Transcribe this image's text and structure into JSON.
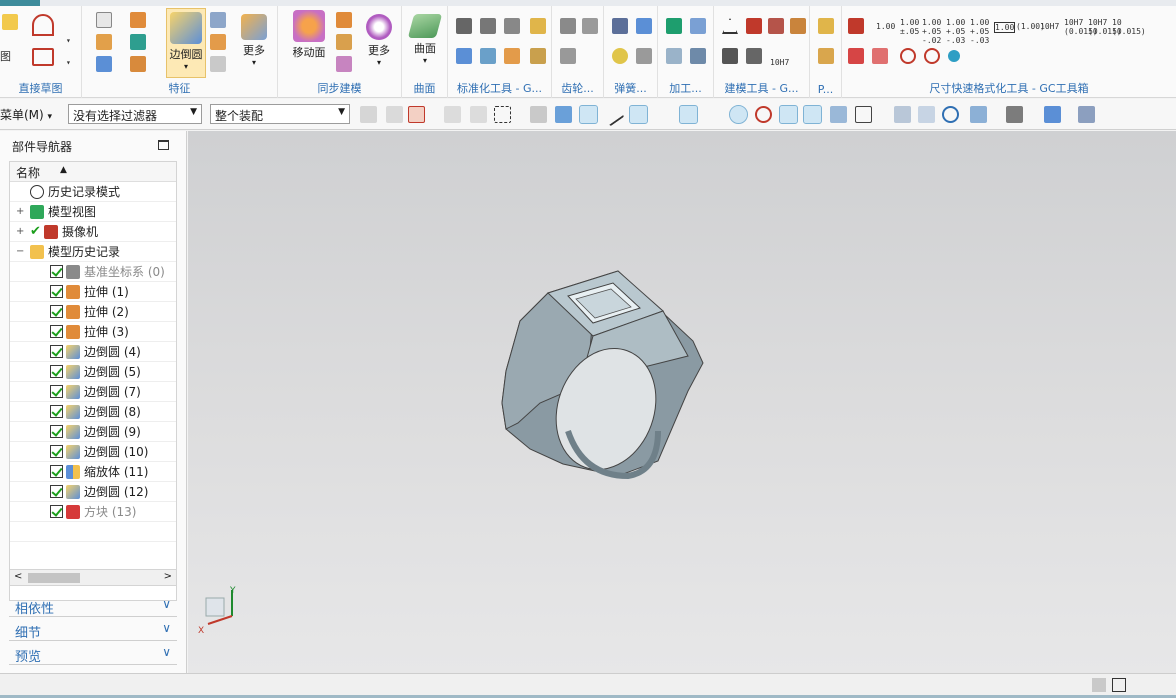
{
  "ribbon": {
    "groups": [
      {
        "label": "直接草图"
      },
      {
        "label": "特征",
        "buttons": [
          {
            "label": "边倒圆"
          },
          {
            "label": "更多"
          }
        ]
      },
      {
        "label": "同步建模",
        "buttons": [
          {
            "label": "移动面"
          },
          {
            "label": "更多"
          }
        ]
      },
      {
        "label": "曲面",
        "buttons": [
          {
            "label": "曲面"
          }
        ]
      },
      {
        "label": "标准化工具 - G..."
      },
      {
        "label": "齿轮..."
      },
      {
        "label": "弹簧..."
      },
      {
        "label": "加工..."
      },
      {
        "label": "建模工具 - G..."
      },
      {
        "label": "P..."
      },
      {
        "label": "尺寸快速格式化工具 - GC工具箱"
      }
    ],
    "left_partial_label": "图",
    "tolerance_icons": [
      "1.00",
      "1.00 ±.05",
      "1.00 +.05 -.02",
      "1.00 +.05 -.03",
      "1.00 +.05 -.03",
      "1.00",
      "(1.00)",
      "10H7",
      "10H7 (0.015)",
      "10H7 (0.015)",
      "10 (0.015)"
    ],
    "ref_label": "10H7"
  },
  "toolbar": {
    "menu_label": "菜单(M)",
    "filter_select": "没有选择过滤器",
    "assembly_select": "整个装配"
  },
  "navigator": {
    "title": "部件导航器",
    "column_header": "名称",
    "items": [
      {
        "label": "历史记录模式",
        "icon": "clock-icon"
      },
      {
        "label": "模型视图",
        "icon": "model-view-icon"
      },
      {
        "label": "摄像机",
        "icon": "camera-icon"
      },
      {
        "label": "模型历史记录",
        "icon": "folder-icon"
      },
      {
        "label": "基准坐标系 (0)",
        "icon": "datum-csys-icon"
      },
      {
        "label": "拉伸 (1)",
        "icon": "extrude-icon"
      },
      {
        "label": "拉伸 (2)",
        "icon": "extrude-icon"
      },
      {
        "label": "拉伸 (3)",
        "icon": "extrude-icon"
      },
      {
        "label": "边倒圆 (4)",
        "icon": "edge-blend-icon"
      },
      {
        "label": "边倒圆 (5)",
        "icon": "edge-blend-icon"
      },
      {
        "label": "边倒圆 (7)",
        "icon": "edge-blend-icon"
      },
      {
        "label": "边倒圆 (8)",
        "icon": "edge-blend-icon"
      },
      {
        "label": "边倒圆 (9)",
        "icon": "edge-blend-icon"
      },
      {
        "label": "边倒圆 (10)",
        "icon": "edge-blend-icon"
      },
      {
        "label": "缩放体 (11)",
        "icon": "scale-body-icon"
      },
      {
        "label": "边倒圆 (12)",
        "icon": "edge-blend-icon"
      },
      {
        "label": "方块 (13)",
        "icon": "block-icon"
      }
    ],
    "sections": [
      {
        "label": "相依性"
      },
      {
        "label": "细节"
      },
      {
        "label": "预览"
      }
    ]
  },
  "viewport": {
    "axis_x": "X",
    "axis_y": "Y"
  },
  "colors": {
    "accent": "#2f6fb3",
    "active_button": "#fde9b5",
    "check_green": "#1b9e1b"
  }
}
